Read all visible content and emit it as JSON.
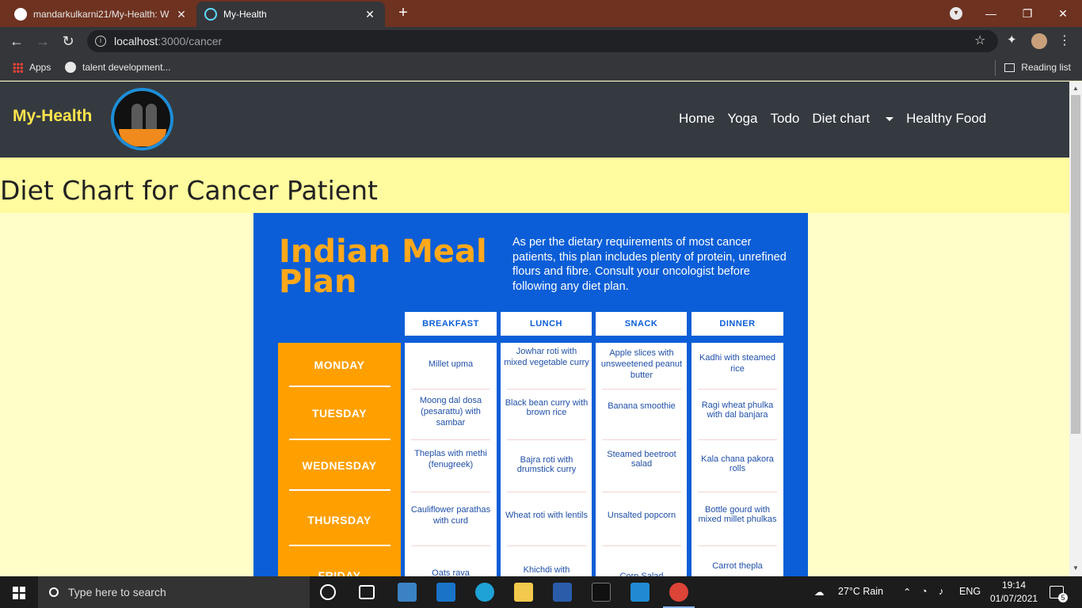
{
  "browser": {
    "tabs": [
      {
        "title": "mandarkulkarni21/My-Health: W",
        "active": false
      },
      {
        "title": "My-Health",
        "active": true
      }
    ],
    "url_host": "localhost",
    "url_path": ":3000/cancer",
    "bookmarks": [
      {
        "label": "Apps",
        "icon": "apps-grid-icon"
      },
      {
        "label": "talent development...",
        "icon": "globe-icon"
      }
    ],
    "reading_list": "Reading list"
  },
  "site": {
    "brand": "My-Health",
    "nav": [
      "Home",
      "Yoga",
      "Todo",
      "Diet chart",
      "Healthy Food"
    ],
    "page_title": "Diet Chart for Cancer Patient"
  },
  "meal_plan": {
    "title_line1": "Indian Meal",
    "title_line2": "Plan",
    "description": "As per the dietary requirements of most cancer patients, this plan includes plenty of protein, unrefined flours and fibre. Consult your oncologist before following any diet plan.",
    "columns": [
      "BREAKFAST",
      "LUNCH",
      "SNACK",
      "DINNER"
    ],
    "days": [
      "MONDAY",
      "TUESDAY",
      "WEDNESDAY",
      "THURSDAY",
      "FRIDAY"
    ],
    "rows": [
      [
        "Millet upma",
        "Jowhar roti with mixed vegetable curry",
        "Apple slices with unsweetened peanut butter",
        "Kadhi with steamed rice"
      ],
      [
        "Moong dal dosa (pesarattu) with sambar",
        "Black bean curry with brown rice",
        "Banana smoothie",
        "Ragi wheat phulka with dal banjara"
      ],
      [
        "Theplas with methi (fenugreek)",
        "Bajra roti with drumstick curry",
        "Steamed beetroot salad",
        "Kala chana pakora rolls"
      ],
      [
        "Cauliflower parathas with curd",
        "Wheat roti with lentils",
        "Unsalted popcorn",
        "Bottle gourd with mixed millet phulkas"
      ],
      [
        "Oats rava",
        "Khichdi with",
        "Corn Salad",
        "Carrot thepla"
      ]
    ]
  },
  "taskbar": {
    "search_placeholder": "Type here to search",
    "weather": "27°C  Rain",
    "language": "ENG",
    "time": "19:14",
    "date": "01/07/2021",
    "notifications": "5"
  },
  "colors": {
    "nav_bg": "#343a40",
    "brand": "#ffe44d",
    "page_bg": "#fffec8",
    "title_band": "#fffb9e",
    "plan_blue": "#0b5ed7",
    "plan_orange": "#ffa000"
  }
}
